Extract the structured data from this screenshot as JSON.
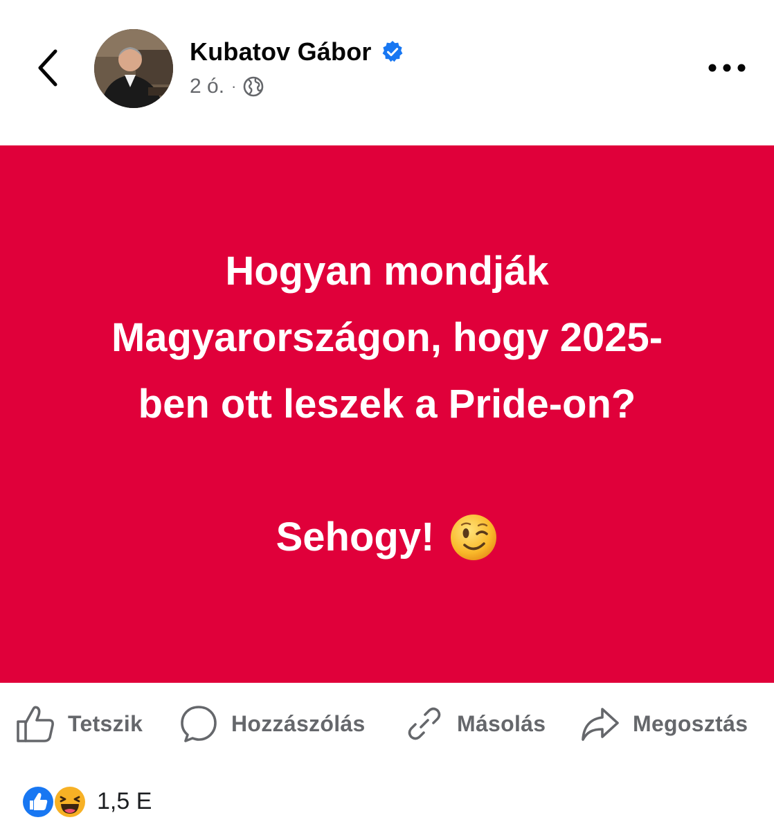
{
  "header": {
    "author_name": "Kubatov Gábor",
    "time_ago": "2 ó.",
    "separator": "·",
    "verified": true,
    "audience_icon": "globe-icon",
    "back_icon": "chevron-left-icon",
    "more_icon": "more-dots-icon"
  },
  "post": {
    "background_color": "#e0003a",
    "text_color": "#ffffff",
    "question": "Hogyan mondják Magyarországon, hogy 2025-ben ott leszek a Pride-on?",
    "answer": "Sehogy!",
    "answer_emoji": "winking-face-emoji"
  },
  "actions": [
    {
      "label": "Tetszik",
      "icon": "thumbs-up-icon"
    },
    {
      "label": "Hozzászólás",
      "icon": "comment-icon"
    },
    {
      "label": "Másolás",
      "icon": "link-icon"
    },
    {
      "label": "Megosztás",
      "icon": "share-icon"
    }
  ],
  "reactions": {
    "types": [
      "like",
      "haha"
    ],
    "count": "1,5 E"
  },
  "colors": {
    "accent_blue": "#1877f2",
    "secondary_text": "#65676b",
    "haha_yellow": "#f7b125"
  }
}
